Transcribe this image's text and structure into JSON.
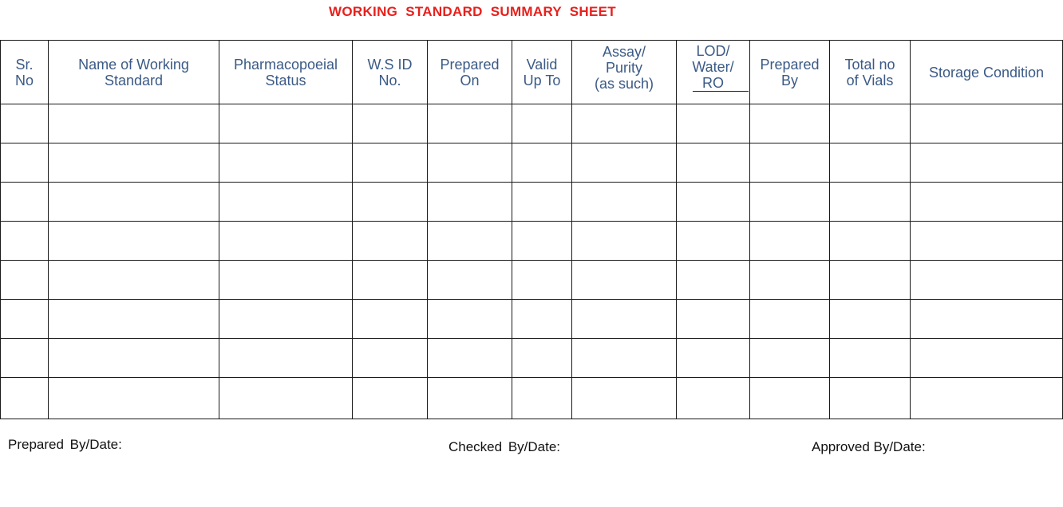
{
  "document": {
    "title": "WORKING STANDARD SUMMARY SHEET",
    "title_color": "#e8201c",
    "header_text_color": "#3b5a86"
  },
  "table": {
    "columns": [
      {
        "key": "sr_no",
        "label": "Sr.\nNo"
      },
      {
        "key": "name",
        "label": "Name of Working\nStandard"
      },
      {
        "key": "pharmacopoeial_status",
        "label": "Pharmacopoeial\nStatus"
      },
      {
        "key": "ws_id",
        "label": "W.S ID\nNo."
      },
      {
        "key": "prepared_on",
        "label": "Prepared\nOn"
      },
      {
        "key": "valid_up_to",
        "label": "Valid\nUp To"
      },
      {
        "key": "assay_purity",
        "label": "Assay/\nPurity\n(as such)"
      },
      {
        "key": "lod_water_ro",
        "label": "LOD/\nWater/\nRO"
      },
      {
        "key": "prepared_by",
        "label": "Prepared\nBy"
      },
      {
        "key": "total_vials",
        "label": "Total no\nof Vials"
      },
      {
        "key": "storage_condition",
        "label": "Storage Condition"
      }
    ],
    "rows": [
      [
        "",
        "",
        "",
        "",
        "",
        "",
        "",
        "",
        "",
        "",
        ""
      ],
      [
        "",
        "",
        "",
        "",
        "",
        "",
        "",
        "",
        "",
        "",
        ""
      ],
      [
        "",
        "",
        "",
        "",
        "",
        "",
        "",
        "",
        "",
        "",
        ""
      ],
      [
        "",
        "",
        "",
        "",
        "",
        "",
        "",
        "",
        "",
        "",
        ""
      ],
      [
        "",
        "",
        "",
        "",
        "",
        "",
        "",
        "",
        "",
        "",
        ""
      ],
      [
        "",
        "",
        "",
        "",
        "",
        "",
        "",
        "",
        "",
        "",
        ""
      ],
      [
        "",
        "",
        "",
        "",
        "",
        "",
        "",
        "",
        "",
        "",
        ""
      ],
      [
        "",
        "",
        "",
        "",
        "",
        "",
        "",
        "",
        "",
        "",
        ""
      ]
    ]
  },
  "footer": {
    "prepared_by": "Prepared  By/Date:",
    "checked_by": "Checked  By/Date:",
    "approved_by": "Approved By/Date:"
  }
}
